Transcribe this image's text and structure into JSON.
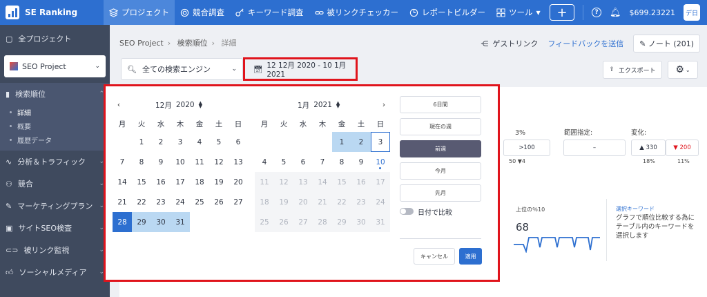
{
  "topbar": {
    "brand": "SE Ranking",
    "nav": [
      {
        "label": "プロジェクト",
        "icon": "layers-icon"
      },
      {
        "label": "競合調査",
        "icon": "target-icon"
      },
      {
        "label": "キーワード調査",
        "icon": "key-icon"
      },
      {
        "label": "被リンクチェッカー",
        "icon": "link-icon"
      },
      {
        "label": "レポートビルダー",
        "icon": "clock-icon"
      },
      {
        "label": "ツール",
        "icon": "grid-icon"
      }
    ],
    "plus": "+",
    "balance": "$699.23221",
    "avatar": "デ日"
  },
  "sidebar": {
    "all_projects": "全プロジェクト",
    "project_selector": "SEO Project",
    "section": "検索順位",
    "sub_items": [
      "詳細",
      "概要",
      "履歴データ"
    ],
    "items": [
      "分析＆トラフィック",
      "競合",
      "マーケティングプラン",
      "サイトSEO検査",
      "被リンク監視",
      "ソーシャルメディア"
    ]
  },
  "header": {
    "breadcrumb": [
      "SEO Project",
      "検索順位",
      "詳細"
    ],
    "guest_link": "ゲストリンク",
    "feedback": "フィードバックを送信",
    "note": "ノート (201)",
    "engine_select": "全ての検索エンジン",
    "date_range": "12 12月 2020 - 10 1月 2021",
    "export": "エクスポート"
  },
  "background": {
    "pct": "3%",
    "range_label": "範囲指定:",
    "change_label": "変化:",
    "box_100": ">100",
    "box_dash": "–",
    "up_val": "▲ 330",
    "down_val": "▼ 200",
    "sub_50": "50 ▼4",
    "pct18": "18%",
    "pct11": "11%",
    "top10_label": "上位の％10",
    "top10_value": "68",
    "kw_label": "選択キーワード",
    "kw_hint": "グラフで順位比較する為にテーブル内のキーワードを選択します"
  },
  "picker": {
    "weekdays": [
      "月",
      "火",
      "水",
      "木",
      "金",
      "土",
      "日"
    ],
    "left": {
      "month": "12月",
      "year": "2020",
      "days": [
        "1",
        "2",
        "3",
        "4",
        "5",
        "6",
        "7",
        "8",
        "9",
        "10",
        "11",
        "12",
        "13",
        "14",
        "15",
        "16",
        "17",
        "18",
        "19",
        "20",
        "21",
        "22",
        "23",
        "24",
        "25",
        "26",
        "27",
        "28",
        "29",
        "30",
        "31"
      ]
    },
    "right": {
      "month": "1月",
      "year": "2021",
      "days": [
        "1",
        "2",
        "3",
        "4",
        "5",
        "6",
        "7",
        "8",
        "9",
        "10",
        "11",
        "12",
        "13",
        "14",
        "15",
        "16",
        "17",
        "18",
        "19",
        "20",
        "21",
        "22",
        "23",
        "24",
        "25",
        "26",
        "27",
        "28",
        "29",
        "30",
        "31"
      ]
    },
    "presets": [
      "6日間",
      "現在の週",
      "前週",
      "今月",
      "先月"
    ],
    "compare": "日付で比較",
    "cancel": "キャンセル",
    "apply": "適用"
  }
}
